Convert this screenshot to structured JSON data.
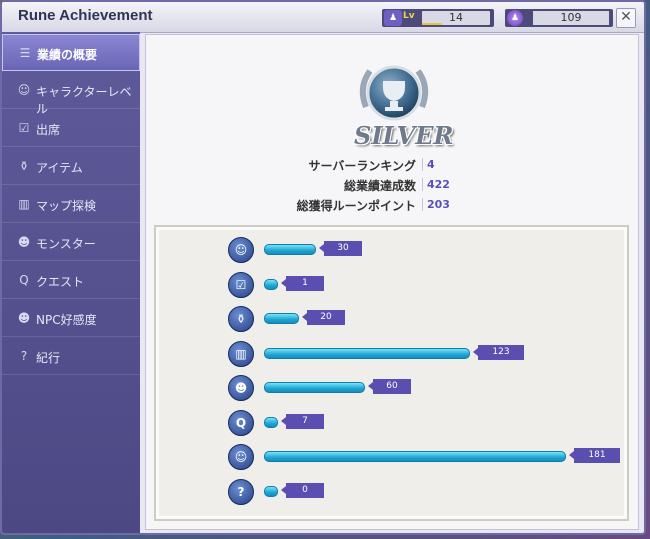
{
  "window": {
    "title": "Rune Achievement"
  },
  "header": {
    "level_tag": "Lv",
    "level": "14",
    "level_progress": 0.3,
    "rune_points": "109",
    "close_label": "✕"
  },
  "sidebar": {
    "items": [
      {
        "label": "業績の概要",
        "icon": "list-icon",
        "glyph": "☰"
      },
      {
        "label": "キャラクターレベル",
        "icon": "character-icon",
        "glyph": "☺"
      },
      {
        "label": "出席",
        "icon": "checkbox-icon",
        "glyph": "☑"
      },
      {
        "label": "アイテム",
        "icon": "item-bag-icon",
        "glyph": "⚱"
      },
      {
        "label": "マップ探検",
        "icon": "map-icon",
        "glyph": "▥"
      },
      {
        "label": "モンスター",
        "icon": "monster-icon",
        "glyph": "☻"
      },
      {
        "label": "クエスト",
        "icon": "quest-icon",
        "glyph": "Q"
      },
      {
        "label": "NPC好感度",
        "icon": "npc-smile-icon",
        "glyph": "☻"
      },
      {
        "label": "紀行",
        "icon": "question-icon",
        "glyph": "?"
      }
    ]
  },
  "main": {
    "rank": "SILVER",
    "stats": [
      {
        "label": "サーバーランキング",
        "value": "4"
      },
      {
        "label": "総業績達成数",
        "value": "422"
      },
      {
        "label": "総獲得ルーンポイント",
        "value": "203"
      }
    ],
    "categories": [
      {
        "icon": "character-icon",
        "glyph": "☺",
        "value": 30,
        "label": "30"
      },
      {
        "icon": "checkbox-icon",
        "glyph": "☑",
        "value": 1,
        "label": "1"
      },
      {
        "icon": "item-bag-icon",
        "glyph": "⚱",
        "value": 20,
        "label": "20"
      },
      {
        "icon": "map-icon",
        "glyph": "▥",
        "value": 123,
        "label": "123"
      },
      {
        "icon": "monster-icon",
        "glyph": "☻",
        "value": 60,
        "label": "60"
      },
      {
        "icon": "quest-icon",
        "glyph": "Q",
        "value": 7,
        "label": "7"
      },
      {
        "icon": "npc-smile-icon",
        "glyph": "☺",
        "value": 181,
        "label": "181"
      },
      {
        "icon": "question-icon",
        "glyph": "?",
        "value": 0,
        "label": "0"
      }
    ]
  },
  "colors": {
    "accent": "#5a4fb0",
    "bar": "#1fa5d4",
    "sidebar": "#5f5b9b"
  }
}
